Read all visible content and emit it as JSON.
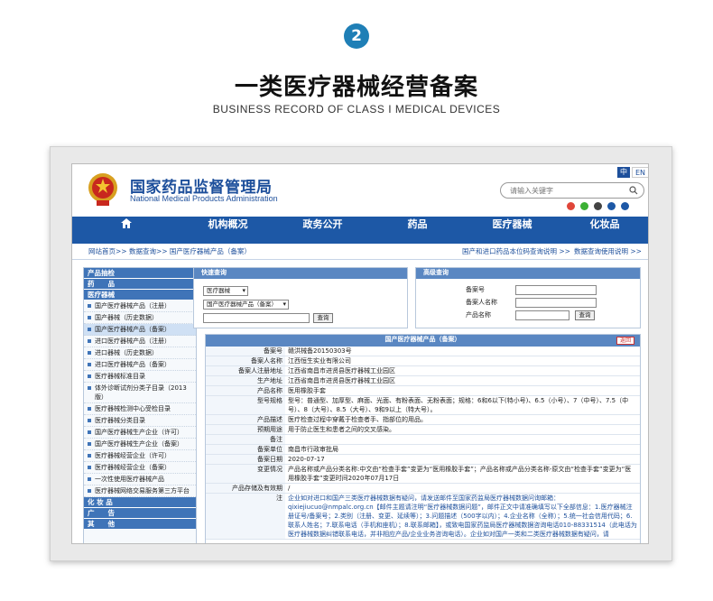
{
  "badge": "2",
  "title": "一类医疗器械经营备案",
  "subtitle": "BUSINESS RECORD OF CLASS I MEDICAL DEVICES",
  "site": {
    "name_cn": "国家药品监督管理局",
    "name_en": "National Medical Products Administration",
    "lang_cn": "中",
    "lang_en": "EN",
    "search_placeholder": "请输入关键字"
  },
  "nav": [
    "机构概况",
    "政务公开",
    "药品",
    "医疗器械",
    "化妆品"
  ],
  "breadcrumb": {
    "left": "网站首页>> 数据查询>> 国产医疗器械产品（备案）",
    "right1": "国产和进口药品本位码查询说明 >>",
    "right2": "数据查询使用说明 >>"
  },
  "sidebar": [
    {
      "type": "head",
      "label": "产品抽检"
    },
    {
      "type": "head",
      "label": "药　　品"
    },
    {
      "type": "head",
      "label": "医疗器械"
    },
    {
      "type": "item",
      "label": "国产医疗器械产品（注册）"
    },
    {
      "type": "item",
      "label": "国产器械（历史数据）"
    },
    {
      "type": "item",
      "label": "国产医疗器械产品（备案）",
      "selected": true
    },
    {
      "type": "item",
      "label": "进口医疗器械产品（注册）"
    },
    {
      "type": "item",
      "label": "进口器械（历史数据）"
    },
    {
      "type": "item",
      "label": "进口医疗器械产品（备案）"
    },
    {
      "type": "item",
      "label": "医疗器械标准目录"
    },
    {
      "type": "item",
      "label": "体外诊断试剂分类子目录（2013版）"
    },
    {
      "type": "item",
      "label": "医疗器械检测中心受检目录"
    },
    {
      "type": "item",
      "label": "医疗器械分类目录"
    },
    {
      "type": "item",
      "label": "国产医疗器械生产企业（许可）"
    },
    {
      "type": "item",
      "label": "国产医疗器械生产企业（备案）"
    },
    {
      "type": "item",
      "label": "医疗器械经营企业（许可）"
    },
    {
      "type": "item",
      "label": "医疗器械经营企业（备案）"
    },
    {
      "type": "item",
      "label": "一次性使用医疗器械产品"
    },
    {
      "type": "item",
      "label": "医疗器械网络交易服务第三方平台"
    },
    {
      "type": "head",
      "label": "化 妆 品"
    },
    {
      "type": "head",
      "label": "广　　告"
    },
    {
      "type": "head",
      "label": "其　　他"
    }
  ],
  "quick": {
    "title": "快速查询",
    "select1": "医疗器械",
    "select2": "国产医疗器械产品（备案）",
    "button": "查询"
  },
  "advanced": {
    "title": "高级查询",
    "f1": "备案号",
    "f2": "备案人名称",
    "f3": "产品名称",
    "button": "查询"
  },
  "detail": {
    "title": "国产医疗器械产品（备案）",
    "back": "返回",
    "rows": [
      {
        "k": "备案号",
        "v": "赣洪械备20150303号"
      },
      {
        "k": "备案人名称",
        "v": "江西恒生实业有限公司"
      },
      {
        "k": "备案人注册地址",
        "v": "江西省南昌市进贤县医疗器械工业园区"
      },
      {
        "k": "生产地址",
        "v": "江西省南昌市进贤县医疗器械工业园区"
      },
      {
        "k": "产品名称",
        "v": "医用橡胶手套"
      },
      {
        "k": "型号规格",
        "v": "型号：普通型、加厚型、麻面、光面、有粉表面、无粉表面；规格：6和6以下(特小号)、6.5（小号）、7（中号）、7.5（中号）、8（大号）、8.5（大号）、9和9以上（特大号）。"
      },
      {
        "k": "产品描述",
        "v": "医疗检查过程中穿戴于检查者手、指部位的用品。"
      },
      {
        "k": "预期用途",
        "v": "用于防止医生和患者之间的交叉感染。"
      },
      {
        "k": "备注",
        "v": ""
      },
      {
        "k": "备案单位",
        "v": "南昌市行政审批局"
      },
      {
        "k": "备案日期",
        "v": "2020-07-17"
      },
      {
        "k": "变更情况",
        "v": "产品名称或产品分类名称:中文由“检查手套”变更为“医用橡胶手套”；产品名称或产品分类名称-原文由“检查手套”变更为“医用橡胶手套”变更时间2020年07月17日"
      },
      {
        "k": "产品存储及有效期",
        "v": "/"
      },
      {
        "k": "注",
        "v": "企业如对进口和国产三类医疗器械数据有疑问，请发送邮件至国家药监局医疗器械数据问询邮箱：qixiejiucuo@nmpalc.org.cn【邮件主题请注明“医疗器械数据问题”，邮件正文中请准确填写以下全部信息：1.医疗器械注册证号/备案号；2.类别（注册、变更、延续等）；3.问题描述（500字以内）；4.企业名称（全称）；5.统一社会信用代码；6.联系人姓名；7.联系电话（手机和座机）；8.联系邮箱】，或致电国家药监局医疗器械数据咨询电话010-88331514（此电话为医疗器械数据纠错联系电话，并非相应产品/企业业务咨询电话）。企业如对国产一类和二类医疗器械数据有疑问，请"
      }
    ]
  },
  "colors": {
    "nav_blue": "#1d58a6",
    "badge_blue": "#1f7fb6",
    "header_blue": "#5a87c2"
  }
}
